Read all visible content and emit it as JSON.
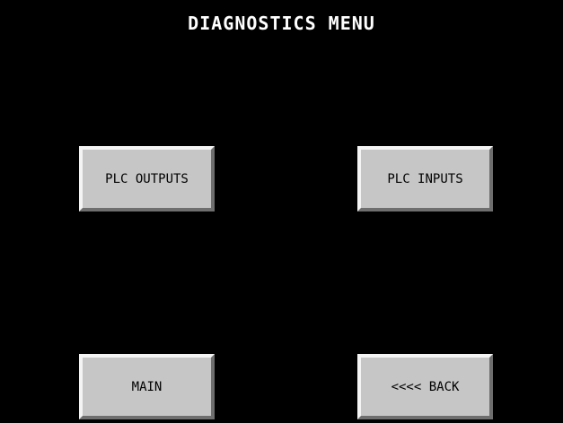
{
  "screen": {
    "title": "DIAGNOSTICS MENU",
    "background_color": "#000000",
    "button_color": "#c6c6c6"
  },
  "buttons": {
    "plc_outputs": "PLC OUTPUTS",
    "plc_inputs": "PLC INPUTS",
    "main": "MAIN",
    "back": "<<<< BACK"
  }
}
